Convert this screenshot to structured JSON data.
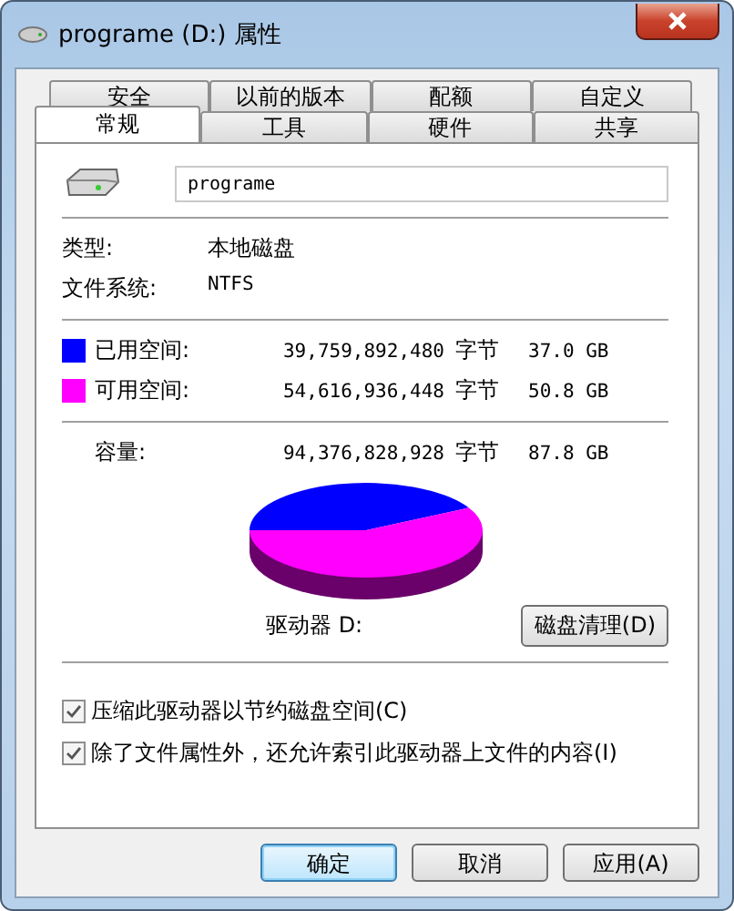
{
  "window": {
    "title": "programe (D:) 属性"
  },
  "tab_rows": [
    [
      {
        "label": "安全",
        "selected": false
      },
      {
        "label": "以前的版本",
        "selected": false
      },
      {
        "label": "配额",
        "selected": false
      },
      {
        "label": "自定义",
        "selected": false
      }
    ],
    [
      {
        "label": "常规",
        "selected": true
      },
      {
        "label": "工具",
        "selected": false
      },
      {
        "label": "硬件",
        "selected": false
      },
      {
        "label": "共享",
        "selected": false
      }
    ]
  ],
  "name_field": {
    "value": "programe"
  },
  "info": [
    {
      "label": "类型:",
      "value": "本地磁盘"
    },
    {
      "label": "文件系统:",
      "value": "NTFS"
    }
  ],
  "space": [
    {
      "label": "已用空间:",
      "bytes": "39,759,892,480",
      "unit": "字节",
      "size": "37.0 GB",
      "color": "#0000ff"
    },
    {
      "label": "可用空间:",
      "bytes": "54,616,936,448",
      "unit": "字节",
      "size": "50.8 GB",
      "color": "#ff00ff"
    }
  ],
  "capacity": {
    "label": "容量:",
    "bytes": "94,376,828,928",
    "unit": "字节",
    "size": "87.8 GB"
  },
  "drive_label": "驱动器 D:",
  "cleanup_button": "磁盘清理(D)",
  "options": [
    {
      "label": "压缩此驱动器以节约磁盘空间(C)",
      "checked": true
    },
    {
      "label": "除了文件属性外，还允许索引此驱动器上文件的内容(I)",
      "checked": true
    }
  ],
  "buttons": [
    {
      "label": "确定",
      "default": true
    },
    {
      "label": "取消",
      "default": false
    },
    {
      "label": "应用(A)",
      "default": false
    }
  ]
}
